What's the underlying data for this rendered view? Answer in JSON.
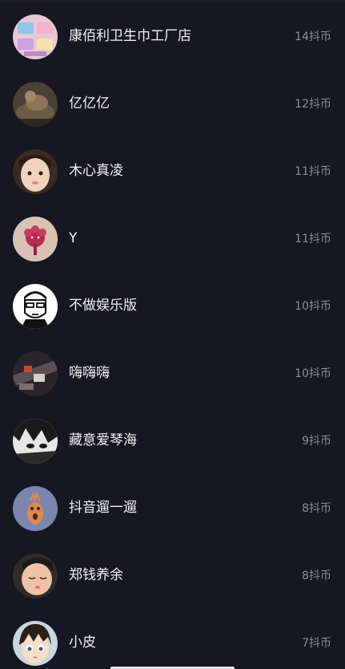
{
  "users": [
    {
      "name": "康佰利卫生巾工厂店",
      "coins": "14抖币"
    },
    {
      "name": "亿亿亿",
      "coins": "12抖币"
    },
    {
      "name": "木心真凌",
      "coins": "11抖币"
    },
    {
      "name": "Y",
      "coins": "11抖币"
    },
    {
      "name": "不做娱乐版",
      "coins": "10抖币"
    },
    {
      "name": "嗨嗨嗨",
      "coins": "10抖币"
    },
    {
      "name": "藏意爱琴海",
      "coins": "9抖币"
    },
    {
      "name": "抖音遛一遛",
      "coins": "8抖币"
    },
    {
      "name": "郑钱养余",
      "coins": "8抖币"
    },
    {
      "name": "小皮",
      "coins": "7抖币"
    }
  ]
}
